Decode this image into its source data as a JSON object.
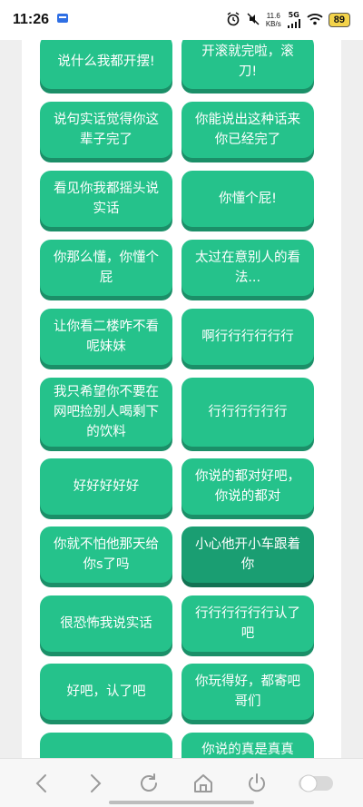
{
  "status": {
    "time": "11:26",
    "net_speed_value": "11.6",
    "net_speed_unit": "KB/s",
    "signal": "5G",
    "battery": "89"
  },
  "buttons": [
    {
      "text": "说什么我都开摆!"
    },
    {
      "text": "开滚就完啦，滚刀!"
    },
    {
      "text": "说句实话觉得你这辈子完了"
    },
    {
      "text": "你能说出这种话来你已经完了"
    },
    {
      "text": "看见你我都摇头说实话"
    },
    {
      "text": "你懂个屁!"
    },
    {
      "text": "你那么懂，你懂个屁"
    },
    {
      "text": "太过在意别人的看法..."
    },
    {
      "text": "让你看二楼咋不看呢妹妹"
    },
    {
      "text": "啊行行行行行行"
    },
    {
      "text": "我只希望你不要在网吧捡别人喝剩下的饮料"
    },
    {
      "text": "行行行行行行"
    },
    {
      "text": "好好好好好"
    },
    {
      "text": "你说的都对好吧，你说的都对"
    },
    {
      "text": "你就不怕他那天给你s了吗"
    },
    {
      "text": "小心他开小车跟着你"
    },
    {
      "text": "很恐怖我说实话"
    },
    {
      "text": "行行行行行行认了吧"
    },
    {
      "text": "好吧，认了吧"
    },
    {
      "text": "你玩得好，都寄吧哥们"
    },
    {
      "text": ""
    },
    {
      "text": "你说的真是真真"
    }
  ],
  "active_index": 15,
  "colors": {
    "button": "#25c28b",
    "button_shadow": "#1b8f68",
    "button_active": "#1a9e72"
  },
  "nav": [
    "back-icon",
    "forward-icon",
    "refresh-icon",
    "home-icon",
    "power-icon",
    "toggle-switch"
  ]
}
